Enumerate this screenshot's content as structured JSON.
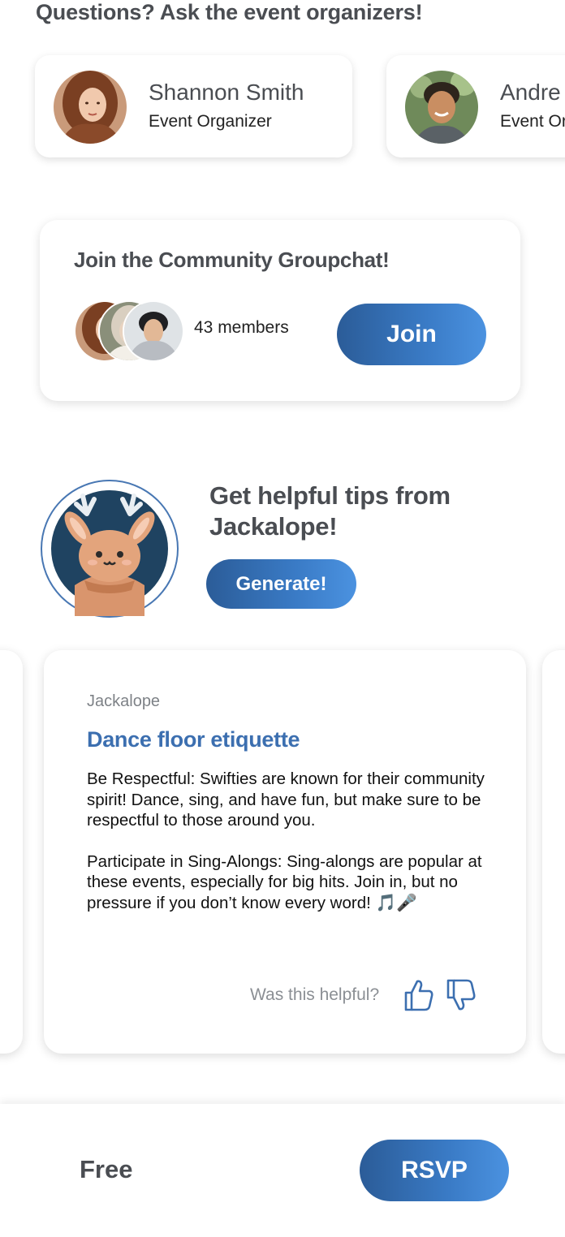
{
  "organizers": {
    "heading": "Questions? Ask the event organizers!",
    "people": [
      {
        "name": "Shannon Smith",
        "role": "Event Organizer"
      },
      {
        "name": "Andre",
        "role": "Event Or"
      }
    ]
  },
  "community": {
    "title": "Join the Community Groupchat!",
    "members_text": "43 members",
    "join_label": "Join"
  },
  "tips": {
    "title": "Get helpful tips from Jackalope!",
    "generate_label": "Generate!",
    "card": {
      "author": "Jackalope",
      "heading": "Dance floor etiquette",
      "paragraphs": [
        "Be Respectful: Swifties are known for their community spirit! Dance, sing, and have fun, but make sure to be respectful to those around you.",
        "Participate in Sing-Alongs: Sing-alongs are popular at these events, especially for big hits. Join in, but no pressure if you don’t know every word! 🎵🎤"
      ],
      "feedback_prompt": "Was this helpful?"
    }
  },
  "footer": {
    "price": "Free",
    "rsvp_label": "RSVP"
  },
  "colors": {
    "accent": "#3a7bc6",
    "heading_blue": "#3c6fb0",
    "text_gray": "#4a4d52"
  },
  "icons": [
    "thumbs-up-icon",
    "thumbs-down-icon"
  ]
}
